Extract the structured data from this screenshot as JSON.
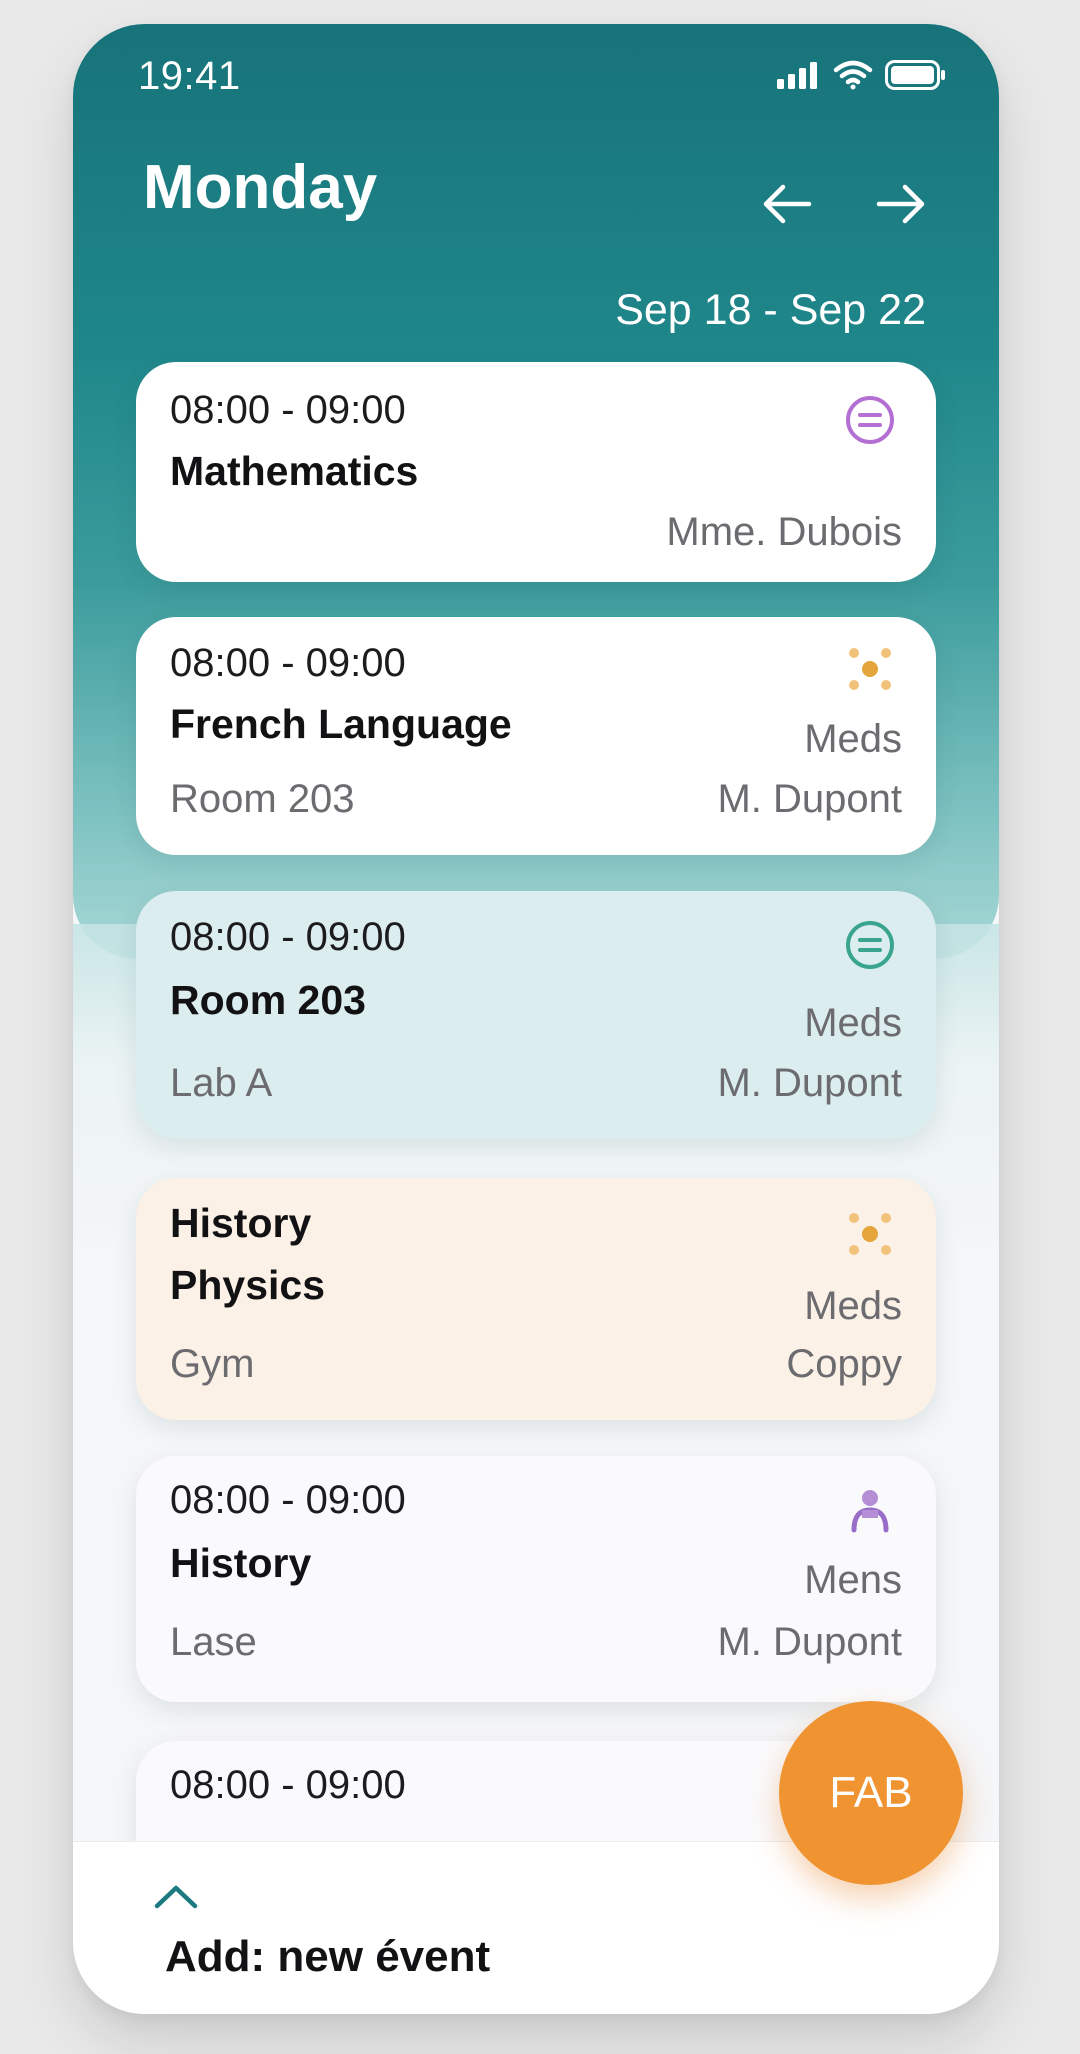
{
  "status_bar": {
    "time": "19:41"
  },
  "header": {
    "title": "Monday",
    "date_range": "Sep 18 - Sep 22",
    "prev_icon": "arrow-left-icon",
    "next_icon": "arrow-right-icon"
  },
  "events": [
    {
      "time": "08:00 - 09:00",
      "subject": "Mathematics",
      "teacher": "Mme. Dubois",
      "icon": "list-circle-icon",
      "icon_color": "#b36fd1"
    },
    {
      "time": "08:00 - 09:00",
      "subject": "French Language",
      "location": "Room 203",
      "tag": "Meds",
      "teacher": "M. Dupont",
      "icon": "dots-icon",
      "icon_color": "#e4a53d"
    },
    {
      "time": "08:00 - 09:00",
      "subject": "Room 203",
      "location": "Lab A",
      "tag": "Meds",
      "teacher": "M. Dupont",
      "icon": "list-circle-icon",
      "icon_color": "#3aa58e"
    },
    {
      "time": "History",
      "subject": "Physics",
      "location": "Gym",
      "tag": "Meds",
      "teacher": "Coppy",
      "icon": "dots-icon",
      "icon_color": "#e4a53d"
    },
    {
      "time": "08:00 - 09:00",
      "subject": "History",
      "location": "Lase",
      "tag": "Mens",
      "teacher": "M. Dupont",
      "icon": "person-icon",
      "icon_color": "#9a6ec8"
    },
    {
      "time": "08:00 - 09:00"
    }
  ],
  "bottom_sheet": {
    "label": "Add: new évent",
    "icon": "chevron-up-icon"
  },
  "fab": {
    "label": "FAB",
    "color": "#ef9431"
  },
  "colors": {
    "header": "#17737a",
    "accent": "#ef9431"
  }
}
